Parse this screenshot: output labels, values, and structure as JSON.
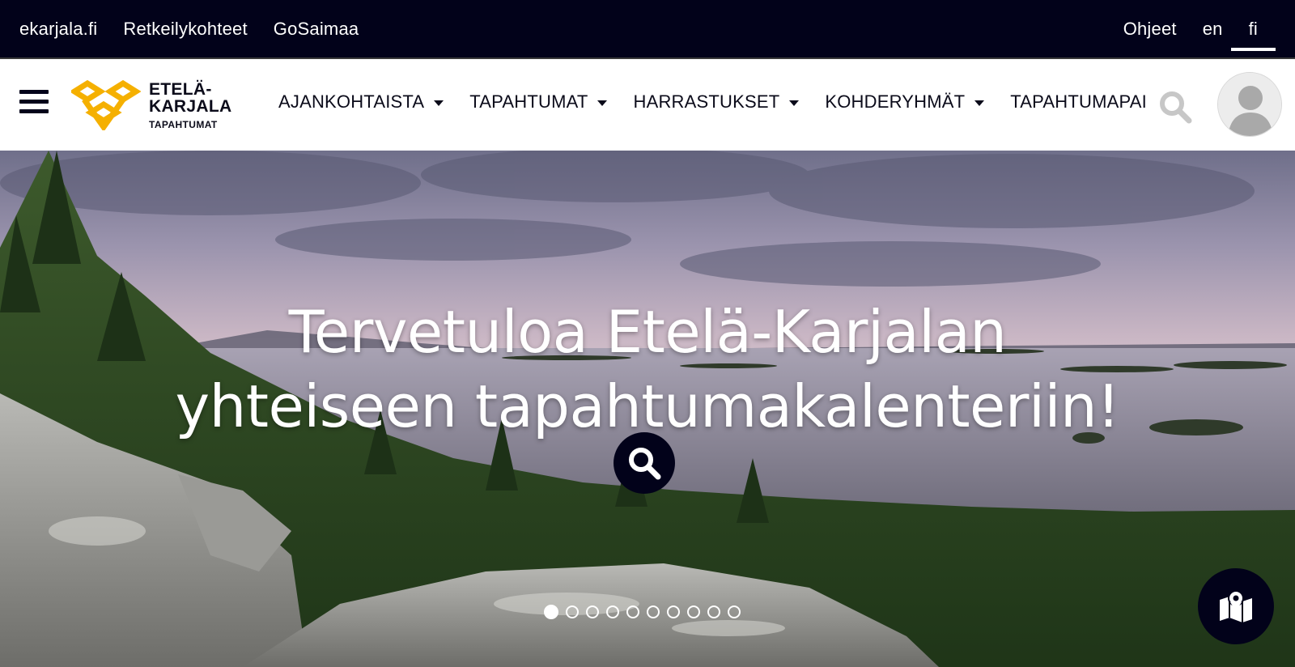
{
  "topbar": {
    "links": [
      "ekarjala.fi",
      "Retkeilykohteet",
      "GoSaimaa"
    ],
    "help": "Ohjeet",
    "lang_en": "en",
    "lang_fi": "fi"
  },
  "logo": {
    "line1": "ETELÄ-",
    "line2": "KARJALA",
    "line3": "TAPAHTUMAT",
    "color": "#f5b000"
  },
  "nav": {
    "items": [
      {
        "label": "AJANKOHTAISTA",
        "has_dropdown": true
      },
      {
        "label": "TAPAHTUMAT",
        "has_dropdown": true
      },
      {
        "label": "HARRASTUKSET",
        "has_dropdown": true
      },
      {
        "label": "KOHDERYHMÄT",
        "has_dropdown": true
      },
      {
        "label": "TAPAHTUMAPAI",
        "has_dropdown": false
      }
    ]
  },
  "hero": {
    "title_line1": "Tervetuloa Etelä-Karjalan",
    "title_line2": "yhteiseen tapahtumakalenteriin!",
    "slides_total": 10,
    "active_slide": 1
  },
  "icons": {
    "menu": "hamburger-menu-icon",
    "header_search": "search-icon",
    "avatar": "user-avatar-icon",
    "hero_search": "search-icon",
    "map": "map-marker-icon"
  },
  "colors": {
    "topbar_bg": "#02021a",
    "accent": "#f5b000",
    "text": "#0b0b1a"
  }
}
